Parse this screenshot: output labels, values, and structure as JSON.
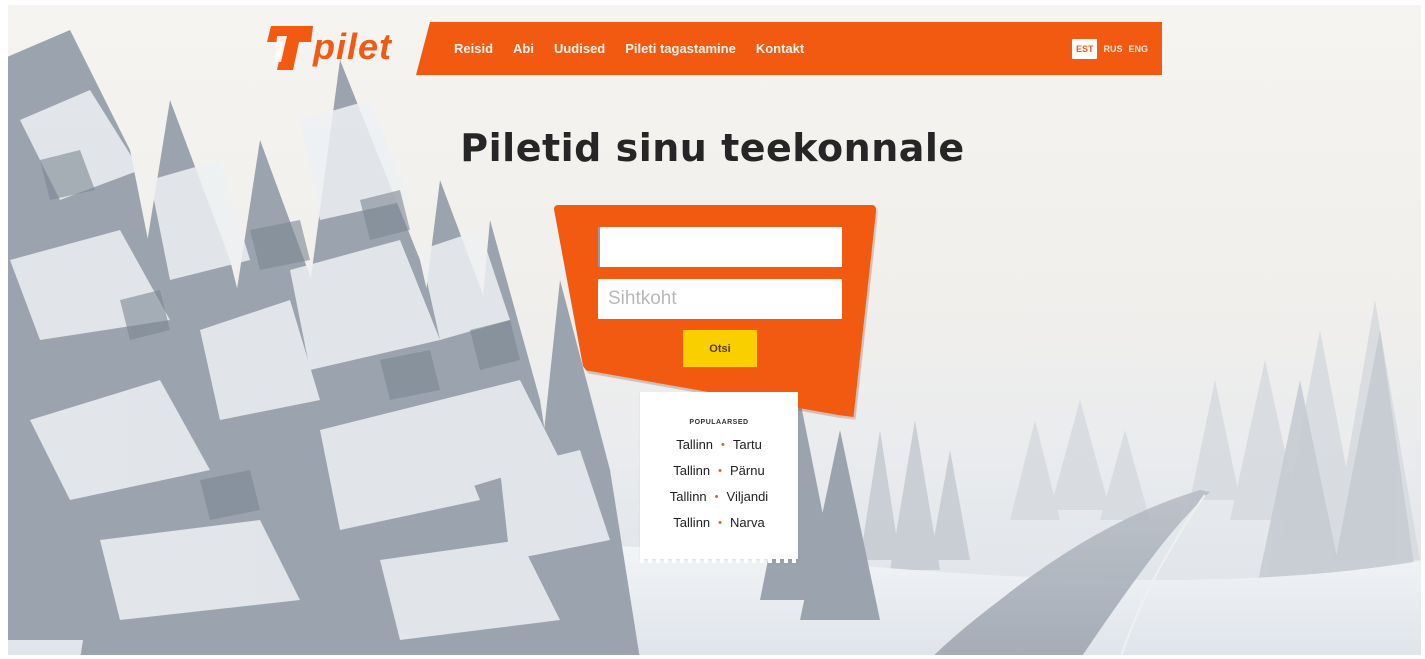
{
  "header": {
    "logo_text": "pilet",
    "nav": [
      "Reisid",
      "Abi",
      "Uudised",
      "Pileti tagastamine",
      "Kontakt"
    ],
    "languages": [
      "EST",
      "RUS",
      "ENG"
    ],
    "active_language": "EST"
  },
  "hero": {
    "title": "Piletid sinu teekonnale"
  },
  "search": {
    "origin_value": "",
    "destination_placeholder": "Sihtkoht",
    "button_label": "Otsi"
  },
  "popular": {
    "title": "POPULAARSED",
    "routes": [
      {
        "from": "Tallinn",
        "to": "Tartu"
      },
      {
        "from": "Tallinn",
        "to": "Pärnu"
      },
      {
        "from": "Tallinn",
        "to": "Viljandi"
      },
      {
        "from": "Tallinn",
        "to": "Narva"
      }
    ],
    "route_separator": "•"
  },
  "colors": {
    "brand": "#f25a12",
    "button": "#f9cf00"
  }
}
